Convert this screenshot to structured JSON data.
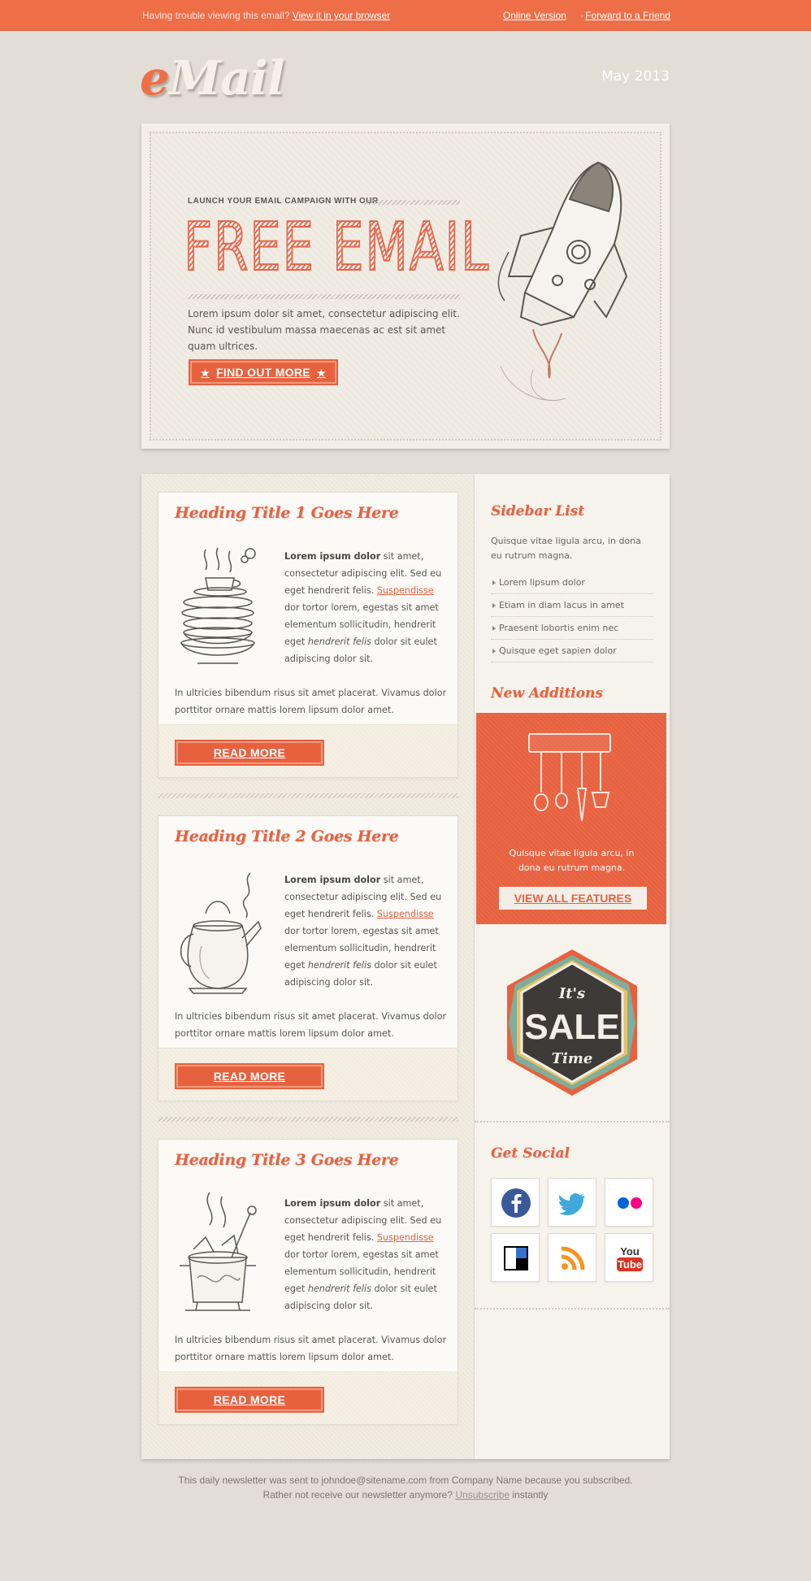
{
  "topbar": {
    "trouble_text": "Having trouble viewing this email?",
    "view_link": "View it in your browser",
    "online_version": "Online Version",
    "forward": "Forward to a Friend"
  },
  "header": {
    "logo_e": "e",
    "logo_rest": "Mail",
    "date": "May 2013"
  },
  "hero": {
    "kicker": "LAUNCH YOUR EMAIL CAMPAIGN WITH OUR",
    "title": "FREE EMAIL",
    "body": "Lorem ipsum dolor sit amet, consectetur adipiscing elit. Nunc id vestibulum massa maecenas ac est sit amet quam ultrices.",
    "button": "FIND OUT MORE",
    "illustration": "rocket-sketch"
  },
  "articles": [
    {
      "title": "Heading Title 1 Goes Here",
      "lead_bold": "Lorem ipsum dolor",
      "lead_rest": " sit amet, consectetur adipiscing elit. Sed eu eget hendrerit felis. ",
      "link": "Suspendisse",
      "mid": " dor tortor lorem, egestas sit amet elementum sollicitudin, hendrerit eget ",
      "italic": "hendrerit felis",
      "end": " dolor sit eulet adipiscing dolor sit.",
      "para2": "In ultricies bibendum risus sit amet placerat. Vivamus dolor porttitor ornare mattis lorem lipsum dolor amet.",
      "button": "READ MORE",
      "illustration": "stacked-dishes"
    },
    {
      "title": "Heading Title 2 Goes Here",
      "lead_bold": "Lorem ipsum dolor",
      "lead_rest": " sit amet, consectetur adipiscing elit. Sed eu eget hendrerit felis. ",
      "link": "Suspendisse",
      "mid": " dor tortor lorem, egestas sit amet elementum sollicitudin, hendrerit eget ",
      "italic": "hendrerit felis",
      "end": " dolor sit eulet adipiscing dolor sit.",
      "para2": "In ultricies bibendum risus sit amet placerat. Vivamus dolor porttitor ornare mattis lorem lipsum dolor amet.",
      "button": "READ MORE",
      "illustration": "kettle"
    },
    {
      "title": "Heading Title 3 Goes Here",
      "lead_bold": "Lorem ipsum dolor",
      "lead_rest": " sit amet, consectetur adipiscing elit. Sed eu eget hendrerit felis. ",
      "link": "Suspendisse",
      "mid": " dor tortor lorem, egestas sit amet elementum sollicitudin, hendrerit eget ",
      "italic": "hendrerit felis",
      "end": " dolor sit eulet adipiscing dolor sit.",
      "para2": "In ultricies bibendum risus sit amet placerat. Vivamus dolor porttitor ornare mattis lorem lipsum dolor amet.",
      "button": "READ MORE",
      "illustration": "boiling-pot"
    }
  ],
  "sidebar": {
    "list_title": "Sidebar List",
    "list_desc": "Quisque vitae ligula arcu, in dona eu rutrum magna.",
    "items": [
      "Lorem lipsum dolor",
      "Etiam in diam lacus in amet",
      "Praesent lobortis enim nec",
      "Quisque eget sapien dolor"
    ],
    "new_title": "New Additions",
    "new_desc": "Quisque vitae ligula arcu, in dona eu rutrum magna.",
    "new_button": "VIEW ALL FEATURES",
    "sale": {
      "top": "It's",
      "middle": "SALE",
      "bottom": "Time"
    },
    "social_title": "Get Social",
    "social": [
      "facebook-icon",
      "twitter-icon",
      "flickr-icon",
      "delicious-icon",
      "rss-icon",
      "youtube-icon"
    ],
    "youtube_top": "You",
    "youtube_bottom": "Tube"
  },
  "footer": {
    "line1": "This daily newsletter was sent to johndoe@sitename.com from Company Name because you subscribed.",
    "line2_pre": "Rather not receive our newsletter anymore?",
    "unsubscribe": "Unsubscribe",
    "line2_post": "instantly"
  },
  "colors": {
    "accent": "#e8613f",
    "topbar": "#ee6e48",
    "background": "#e2ddd5"
  }
}
